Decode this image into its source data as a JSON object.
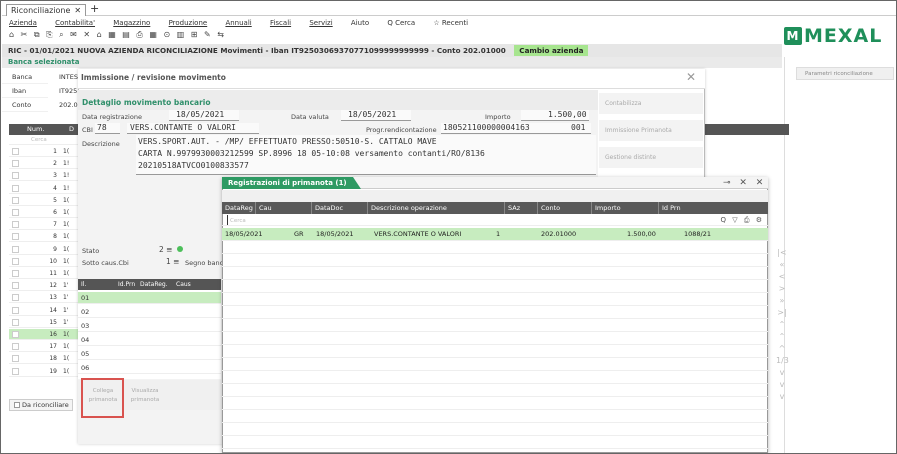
{
  "tab": {
    "label": "Riconciliazione",
    "close": "✕",
    "add": "+"
  },
  "menu": [
    "Azienda",
    "Contabilita'",
    "Magazzino",
    "Produzione",
    "Annuali",
    "Fiscali",
    "Servizi",
    "Aiuto",
    "Q Cerca",
    "☆ Recenti"
  ],
  "toolbar_glyphs": "⌂ ✂ ⧉ ⎘ ⌕ ✉ ✕ ⌂ ▦ ▤ ⎙ ▦ ⊙ ▥ ⊞ ✎ ⇆",
  "logo": {
    "text": "MEXAL",
    "mark": "M"
  },
  "title_bar": {
    "text": "RIC - 01/01/2021  NUOVA AZIENDA RICONCILIAZIONE  Movimenti - Iban IT92503069370771099999999999 - Conto 202.01000",
    "button": "Cambio azienda"
  },
  "banca_selezionata": "Banca selezionata",
  "left_info": {
    "labels": [
      "Banca",
      "Iban",
      "Conto"
    ],
    "values": [
      "INTES",
      "IT925",
      "202.0"
    ]
  },
  "right_panel": {
    "param_button": "Parametri riconciliazione"
  },
  "main_list": {
    "headers": [
      "Num.",
      "D"
    ],
    "cerca": "Cerca",
    "rows": [
      {
        "n": "1",
        "d": "1("
      },
      {
        "n": "2",
        "d": "1!"
      },
      {
        "n": "3",
        "d": "1!"
      },
      {
        "n": "4",
        "d": "1!"
      },
      {
        "n": "5",
        "d": "1("
      },
      {
        "n": "6",
        "d": "1("
      },
      {
        "n": "7",
        "d": "1("
      },
      {
        "n": "8",
        "d": "1("
      },
      {
        "n": "9",
        "d": "1("
      },
      {
        "n": "10",
        "d": "1("
      },
      {
        "n": "11",
        "d": "1("
      },
      {
        "n": "12",
        "d": "1'"
      },
      {
        "n": "13",
        "d": "1'"
      },
      {
        "n": "14",
        "d": "1'"
      },
      {
        "n": "15",
        "d": "1'"
      },
      {
        "n": "16",
        "d": "1("
      },
      {
        "n": "17",
        "d": "1("
      },
      {
        "n": "18",
        "d": "1("
      },
      {
        "n": "19",
        "d": "1("
      }
    ],
    "da_riconciliare": "Da riconciliare"
  },
  "dialog1": {
    "title": "Immissione / revisione movimento",
    "subtitle": "Dettaglio movimento bancario",
    "data_registrazione_label": "Data registrazione",
    "data_registrazione": "18/05/2021",
    "data_valuta_label": "Data valuta",
    "data_valuta": "18/05/2021",
    "importo_label": "Importo",
    "importo": "1.500,00",
    "cbi_label": "CBI",
    "cbi": "78",
    "cbi_desc": "VERS.CONTANTE O VALORI",
    "progr_label": "Progr.rendicontazione",
    "progr": "180521100000004163",
    "progr_suffix": "001",
    "descrizione_label": "Descrizione",
    "descrizione": [
      "VERS.SPORT.AUT.                  - /MP/ EFFETTUATO PRESSO:50510-S. CATTALO MAVE",
      "CARTA N.9979930003212599 SP.8996 18 05-10:08 versamento contanti/RO/8136",
      "20210518ATVCO0100833577"
    ],
    "stato_label": "Stato",
    "stato": "2 ≡",
    "sotto_caus_label": "Sotto caus.Cbi",
    "sotto_caus": "1 ≡",
    "segno_label": "Segno banca",
    "side_buttons": [
      "Contabilizza",
      "Immissione Primanota",
      "Gestione distinte"
    ],
    "sub_headers": [
      "Il.",
      "Id.Prn",
      "DataReg.",
      "Caus"
    ],
    "sub_rows": [
      "01",
      "02",
      "03",
      "04",
      "05",
      "06"
    ],
    "btn_collega": "Collega primanota",
    "btn_visualizza": "Visualizza primanota",
    "close": "✕"
  },
  "dialog2": {
    "title": "Registrazioni di primanota (1)",
    "icons": "⊸ ✕ ✕",
    "headers": [
      "DataReg",
      "Cau",
      "DataDoc",
      "Descrizione operazione",
      "SAz",
      "Conto",
      "Importo",
      "Id Prn"
    ],
    "cerca": "Cerca",
    "cerca_icons": "Q ▽ ⎙ ⚙",
    "rows": [
      {
        "datareg": "18/05/2021",
        "cau": "GR",
        "datadoc": "18/05/2021",
        "descr": "VERS.CONTANTE O VALORI",
        "saz": "1",
        "conto": "202.01000",
        "importo": "1.500,00",
        "idprn": "1088/21"
      }
    ]
  },
  "side_nav_glyphs": [
    "|<",
    "«",
    "<",
    ">",
    "»",
    ">|",
    "⌃",
    "⌃",
    "^",
    "1/3",
    "v",
    "v",
    "v"
  ]
}
